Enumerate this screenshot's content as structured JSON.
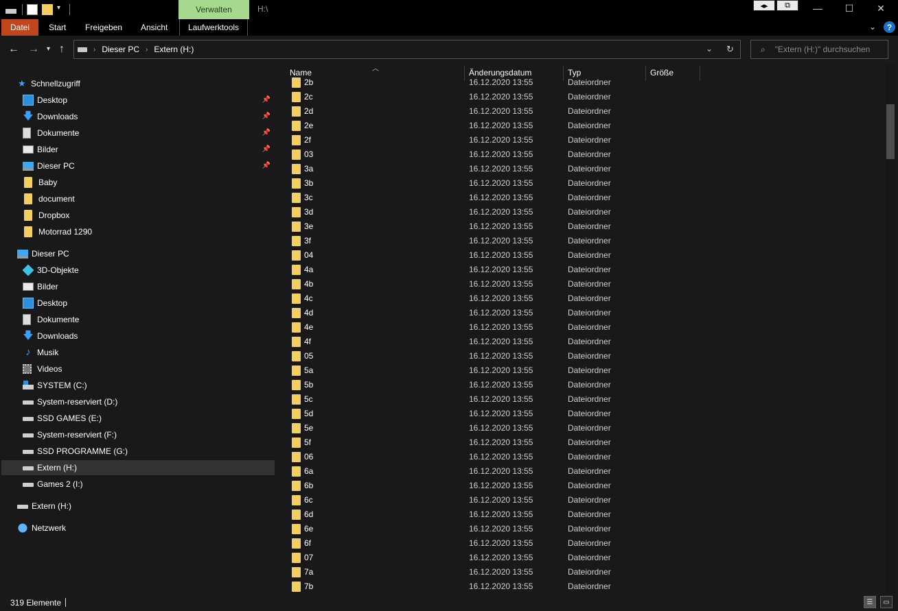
{
  "window": {
    "title": "H:\\",
    "contextual_tab": "Verwalten",
    "controls": {
      "minimize": "—",
      "maximize": "☐",
      "close": "✕"
    }
  },
  "ribbon": {
    "tabs": [
      "Datei",
      "Start",
      "Freigeben",
      "Ansicht",
      "Laufwerktools"
    ],
    "help": "?"
  },
  "address": {
    "breadcrumbs": [
      "Dieser PC",
      "Extern (H:)"
    ],
    "search_placeholder": "\"Extern (H:)\" durchsuchen"
  },
  "navigation": {
    "quick_access": {
      "label": "Schnellzugriff",
      "items": [
        {
          "label": "Desktop",
          "icon": "desktop-icon",
          "pinned": true
        },
        {
          "label": "Downloads",
          "icon": "download-icon",
          "pinned": true
        },
        {
          "label": "Dokumente",
          "icon": "document-icon",
          "pinned": true
        },
        {
          "label": "Bilder",
          "icon": "picture-icon",
          "pinned": true
        },
        {
          "label": "Dieser PC",
          "icon": "computer-icon",
          "pinned": true
        },
        {
          "label": "Baby",
          "icon": "folder-icon",
          "pinned": false
        },
        {
          "label": "document",
          "icon": "folder-icon",
          "pinned": false
        },
        {
          "label": "Dropbox",
          "icon": "folder-icon",
          "pinned": false
        },
        {
          "label": "Motorrad 1290",
          "icon": "folder-icon",
          "pinned": false
        }
      ]
    },
    "this_pc": {
      "label": "Dieser PC",
      "items": [
        {
          "label": "3D-Objekte",
          "icon": "3d-objects-icon"
        },
        {
          "label": "Bilder",
          "icon": "picture-icon"
        },
        {
          "label": "Desktop",
          "icon": "desktop-icon"
        },
        {
          "label": "Dokumente",
          "icon": "document-icon"
        },
        {
          "label": "Downloads",
          "icon": "download-icon"
        },
        {
          "label": "Musik",
          "icon": "music-icon"
        },
        {
          "label": "Videos",
          "icon": "video-icon"
        },
        {
          "label": "SYSTEM (C:)",
          "icon": "system-drive-icon"
        },
        {
          "label": "System-reserviert (D:)",
          "icon": "drive-icon"
        },
        {
          "label": "SSD GAMES (E:)",
          "icon": "drive-icon"
        },
        {
          "label": "System-reserviert (F:)",
          "icon": "drive-icon"
        },
        {
          "label": "SSD PROGRAMME (G:)",
          "icon": "drive-icon"
        },
        {
          "label": "Extern (H:)",
          "icon": "drive-icon",
          "selected": true
        },
        {
          "label": "Games 2 (I:)",
          "icon": "drive-icon"
        }
      ]
    },
    "extern": {
      "label": "Extern (H:)"
    },
    "network": {
      "label": "Netzwerk"
    }
  },
  "columns": {
    "name": "Name",
    "date": "Änderungsdatum",
    "type": "Typ",
    "size": "Größe"
  },
  "files": [
    {
      "name": "2b",
      "date": "16.12.2020 13:55",
      "type": "Dateiordner"
    },
    {
      "name": "2c",
      "date": "16.12.2020 13:55",
      "type": "Dateiordner"
    },
    {
      "name": "2d",
      "date": "16.12.2020 13:55",
      "type": "Dateiordner"
    },
    {
      "name": "2e",
      "date": "16.12.2020 13:55",
      "type": "Dateiordner"
    },
    {
      "name": "2f",
      "date": "16.12.2020 13:55",
      "type": "Dateiordner"
    },
    {
      "name": "03",
      "date": "16.12.2020 13:55",
      "type": "Dateiordner"
    },
    {
      "name": "3a",
      "date": "16.12.2020 13:55",
      "type": "Dateiordner"
    },
    {
      "name": "3b",
      "date": "16.12.2020 13:55",
      "type": "Dateiordner"
    },
    {
      "name": "3c",
      "date": "16.12.2020 13:55",
      "type": "Dateiordner"
    },
    {
      "name": "3d",
      "date": "16.12.2020 13:55",
      "type": "Dateiordner"
    },
    {
      "name": "3e",
      "date": "16.12.2020 13:55",
      "type": "Dateiordner"
    },
    {
      "name": "3f",
      "date": "16.12.2020 13:55",
      "type": "Dateiordner"
    },
    {
      "name": "04",
      "date": "16.12.2020 13:55",
      "type": "Dateiordner"
    },
    {
      "name": "4a",
      "date": "16.12.2020 13:55",
      "type": "Dateiordner"
    },
    {
      "name": "4b",
      "date": "16.12.2020 13:55",
      "type": "Dateiordner"
    },
    {
      "name": "4c",
      "date": "16.12.2020 13:55",
      "type": "Dateiordner"
    },
    {
      "name": "4d",
      "date": "16.12.2020 13:55",
      "type": "Dateiordner"
    },
    {
      "name": "4e",
      "date": "16.12.2020 13:55",
      "type": "Dateiordner"
    },
    {
      "name": "4f",
      "date": "16.12.2020 13:55",
      "type": "Dateiordner"
    },
    {
      "name": "05",
      "date": "16.12.2020 13:55",
      "type": "Dateiordner"
    },
    {
      "name": "5a",
      "date": "16.12.2020 13:55",
      "type": "Dateiordner"
    },
    {
      "name": "5b",
      "date": "16.12.2020 13:55",
      "type": "Dateiordner"
    },
    {
      "name": "5c",
      "date": "16.12.2020 13:55",
      "type": "Dateiordner"
    },
    {
      "name": "5d",
      "date": "16.12.2020 13:55",
      "type": "Dateiordner"
    },
    {
      "name": "5e",
      "date": "16.12.2020 13:55",
      "type": "Dateiordner"
    },
    {
      "name": "5f",
      "date": "16.12.2020 13:55",
      "type": "Dateiordner"
    },
    {
      "name": "06",
      "date": "16.12.2020 13:55",
      "type": "Dateiordner"
    },
    {
      "name": "6a",
      "date": "16.12.2020 13:55",
      "type": "Dateiordner"
    },
    {
      "name": "6b",
      "date": "16.12.2020 13:55",
      "type": "Dateiordner"
    },
    {
      "name": "6c",
      "date": "16.12.2020 13:55",
      "type": "Dateiordner"
    },
    {
      "name": "6d",
      "date": "16.12.2020 13:55",
      "type": "Dateiordner"
    },
    {
      "name": "6e",
      "date": "16.12.2020 13:55",
      "type": "Dateiordner"
    },
    {
      "name": "6f",
      "date": "16.12.2020 13:55",
      "type": "Dateiordner"
    },
    {
      "name": "07",
      "date": "16.12.2020 13:55",
      "type": "Dateiordner"
    },
    {
      "name": "7a",
      "date": "16.12.2020 13:55",
      "type": "Dateiordner"
    },
    {
      "name": "7b",
      "date": "16.12.2020 13:55",
      "type": "Dateiordner"
    }
  ],
  "status": {
    "count": "319 Elemente"
  },
  "colors": {
    "accent_file_tab": "#c0461e",
    "context_tab": "#a6d98e",
    "folder": "#f3cf61",
    "background": "#191919"
  }
}
